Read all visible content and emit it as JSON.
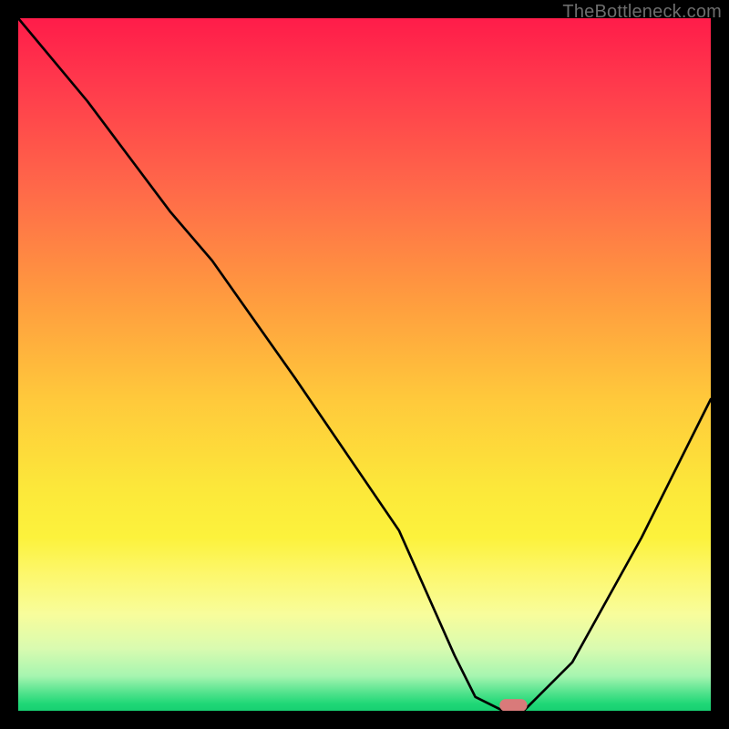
{
  "watermark": "TheBottleneck.com",
  "chart_data": {
    "type": "line",
    "title": "",
    "xlabel": "",
    "ylabel": "",
    "xlim": [
      0,
      100
    ],
    "ylim": [
      0,
      100
    ],
    "grid": false,
    "background": "red-to-green vertical gradient",
    "series": [
      {
        "name": "curve",
        "color": "#000000",
        "x": [
          0,
          10,
          22,
          28,
          40,
          55,
          63,
          66,
          70,
          73,
          80,
          90,
          100
        ],
        "y": [
          100,
          88,
          72,
          65,
          48,
          26,
          8,
          2,
          0,
          0,
          7,
          25,
          45
        ]
      }
    ],
    "marker": {
      "shape": "rounded-rect",
      "x": 71.5,
      "y": 0.8,
      "width": 4,
      "height": 1.8,
      "color": "#d97a7a"
    }
  }
}
